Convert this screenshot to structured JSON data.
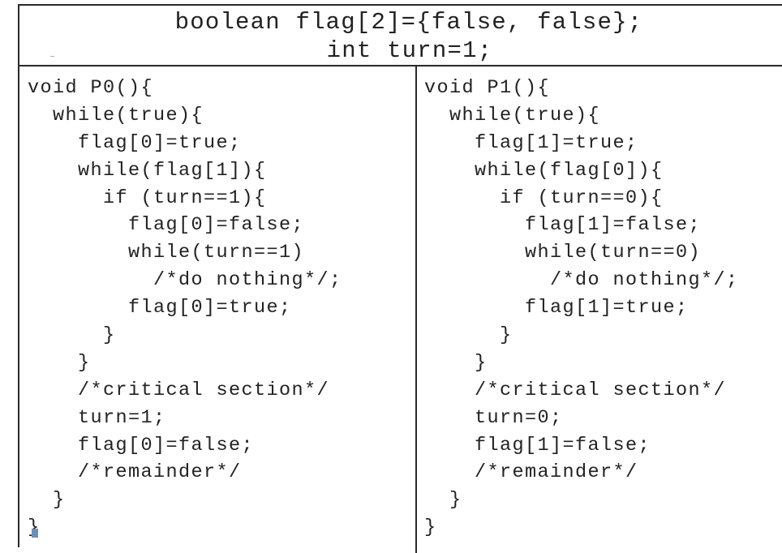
{
  "header": {
    "line1": "boolean flag[2]={false, false};",
    "line2": "int turn=1;"
  },
  "p0": {
    "lines": [
      "void P0(){",
      "  while(true){",
      "    flag[0]=true;",
      "    while(flag[1]){",
      "      if (turn==1){",
      "        flag[0]=false;",
      "        while(turn==1)",
      "          /*do nothing*/;",
      "        flag[0]=true;",
      "      }",
      "    }",
      "    /*critical section*/",
      "    turn=1;",
      "    flag[0]=false;",
      "    /*remainder*/",
      "  }",
      "}"
    ]
  },
  "p1": {
    "lines": [
      "void P1(){",
      "  while(true){",
      "    flag[1]=true;",
      "    while(flag[0]){",
      "      if (turn==0){",
      "        flag[1]=false;",
      "        while(turn==0)",
      "          /*do nothing*/;",
      "        flag[1]=true;",
      "      }",
      "    }",
      "    /*critical section*/",
      "    turn=0;",
      "    flag[1]=false;",
      "    /*remainder*/",
      "  }",
      "}"
    ]
  }
}
